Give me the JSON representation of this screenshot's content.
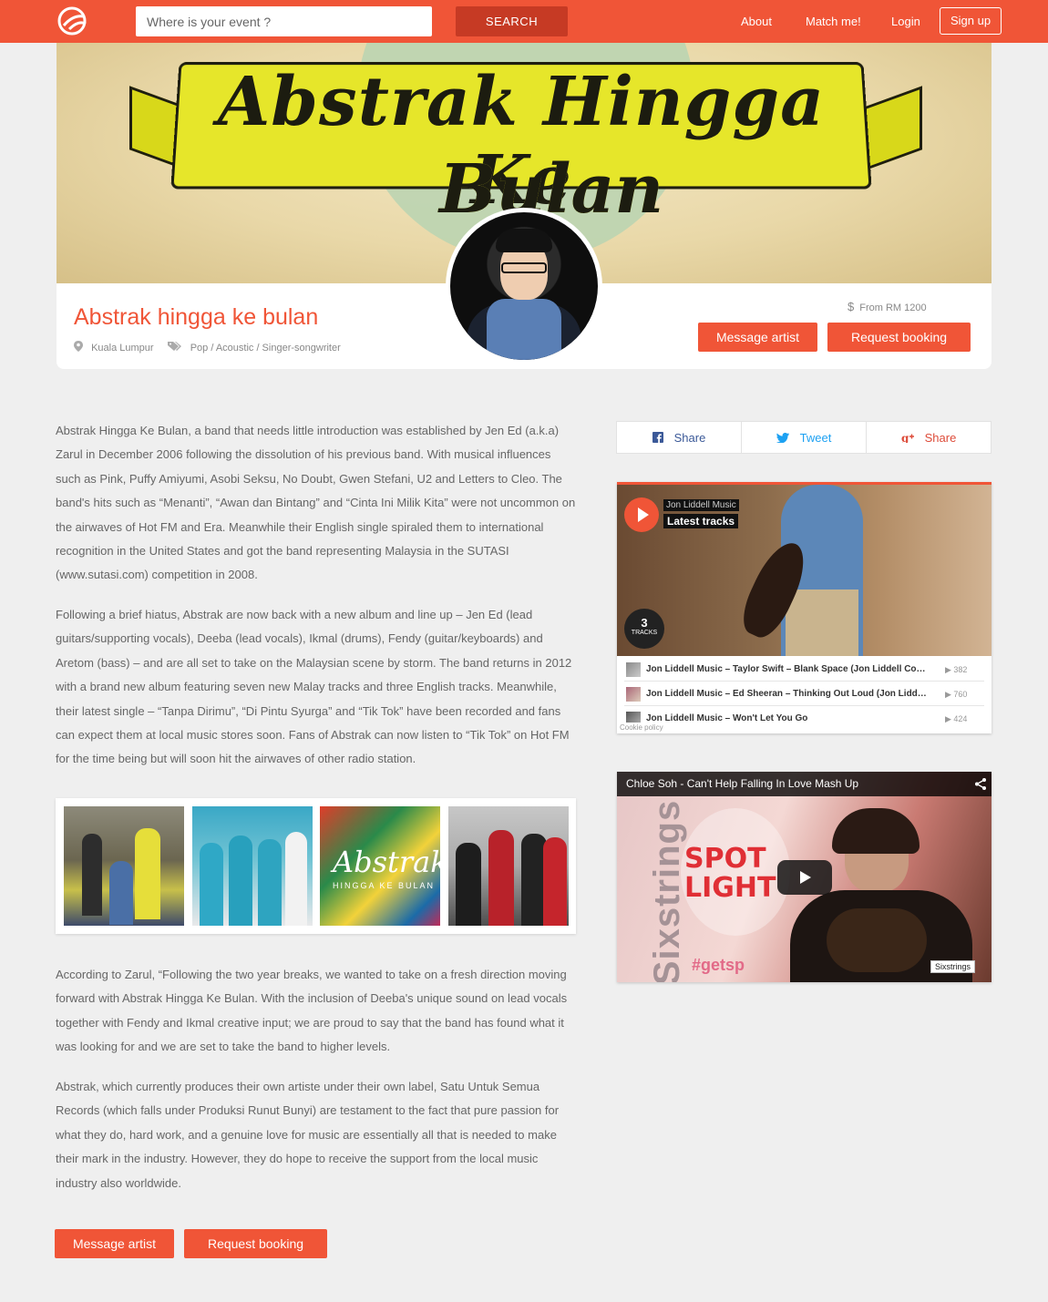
{
  "nav": {
    "search_placeholder": "Where is your event ?",
    "search_button": "SEARCH",
    "links": [
      "About",
      "Match me!",
      "Login"
    ],
    "signup": "Sign up"
  },
  "hero": {
    "title_line1": "Abstrak Hingga Ke",
    "title_line2": "Bulan"
  },
  "artist": {
    "name": "Abstrak hingga ke bulan",
    "location": "Kuala Lumpur",
    "genres": "Pop / Acoustic / Singer-songwriter",
    "price": "From RM 1200",
    "message_button": "Message artist",
    "booking_button": "Request booking"
  },
  "bio": {
    "p1": "Abstrak Hingga Ke Bulan, a band that needs little introduction was established by Jen Ed (a.k.a) Zarul in December 2006 following the dissolution of his previous band. With musical influences such as Pink, Puffy Amiyumi, Asobi Seksu, No Doubt, Gwen Stefani, U2 and Letters to Cleo. The band's hits such as “Menanti”, “Awan dan Bintang” and “Cinta Ini Milik Kita” were not uncommon on the airwaves of Hot FM and Era. Meanwhile their English single spiraled them to international recognition in the United States and got the band representing Malaysia in the SUTASI (www.sutasi.com) competition in 2008.",
    "p2": "Following a brief hiatus, Abstrak are now back with a new album and line up – Jen Ed (lead guitars/supporting vocals), Deeba (lead vocals), Ikmal (drums), Fendy (guitar/keyboards) and Aretom (bass) – and are all set to take on the Malaysian scene by storm. The band returns in 2012 with a brand new album featuring seven new Malay tracks and three English tracks. Meanwhile, their latest single – “Tanpa Dirimu”, “Di Pintu Syurga” and “Tik Tok” have been recorded and fans can expect them at local music stores soon. Fans of Abstrak can now listen to “Tik Tok” on Hot FM for the time being but will soon hit the airwaves of other radio station.",
    "p3": "According to Zarul, “Following the two year breaks, we wanted to take on a fresh direction moving forward with Abstrak Hingga Ke Bulan. With the inclusion of Deeba's unique sound on lead vocals together with Fendy and Ikmal creative input; we are proud to say that the band has found what it was looking for and we are set to take the band to higher levels.",
    "p4": "Abstrak, which currently produces their own artiste under their own label, Satu Untuk Semua Records (which falls under Produksi Runut Bunyi) are testament to the fact that pure passion for what they do, hard work, and a genuine love for music are essentially all that is needed to make their mark in the industry. However, they do hope to receive the support from the local music industry also worldwide."
  },
  "gallery": {
    "album_text": "Abstrak",
    "album_subtext": "HINGGA KE BULAN"
  },
  "share": {
    "facebook": "Share",
    "twitter": "Tweet",
    "google": "Share"
  },
  "soundcloud": {
    "user": "Jon Liddell Music",
    "title": "Latest tracks",
    "track_count": "3",
    "track_label": "TRACKS",
    "tracks": [
      {
        "title": "Jon Liddell Music – Taylor Swift – Blank Space (Jon Liddell Co…",
        "plays": "382"
      },
      {
        "title": "Jon Liddell Music – Ed Sheeran – Thinking Out Loud (Jon Lidd…",
        "plays": "760"
      },
      {
        "title": "Jon Liddell Music – Won't Let You Go",
        "plays": "424"
      }
    ],
    "cookie": "Cookie policy"
  },
  "video": {
    "title": "Chloe Soh - Can't Help Falling In Love Mash Up",
    "brand": "Sixstrings",
    "side_text": "Sixstrings",
    "spot_line1": "SPOT",
    "spot_line2": "LIGHT",
    "hashtag": "#getsp"
  },
  "colors": {
    "accent": "#f05537",
    "accent_dark": "#c63a24",
    "facebook": "#3b5998",
    "twitter": "#1da1f2",
    "google": "#dd4b39"
  }
}
